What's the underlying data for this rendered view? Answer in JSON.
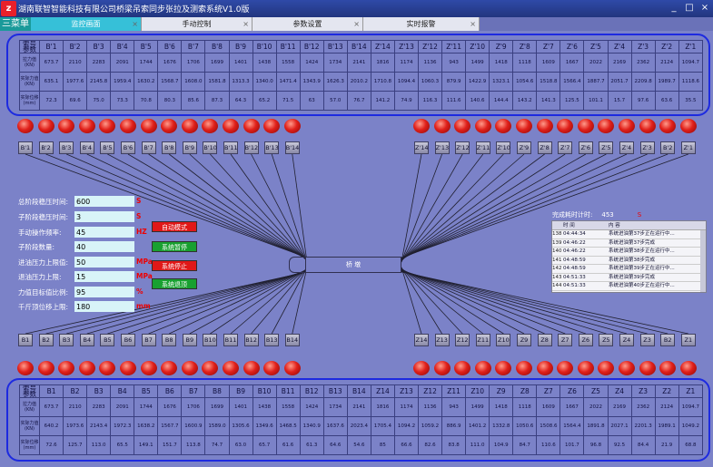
{
  "app": {
    "title": "湖南联智智能科技有限公司桥梁吊索同步张拉及测索系统V1.0版",
    "logo": "z",
    "win_min": "_",
    "win_max": "□",
    "win_close": "×"
  },
  "menu_label": "三菜单",
  "tabs": [
    {
      "label": "监控画面"
    },
    {
      "label": "手动控制"
    },
    {
      "label": "参数设置"
    },
    {
      "label": "实时报警"
    }
  ],
  "tab_close": "×",
  "row_labels": {
    "corner_top": "索号",
    "corner_bottom": "参数",
    "force": "拉力值(KN)",
    "actual_force": "实际力值(KN)",
    "displacement": "实际位移(mm)"
  },
  "top_table": {
    "headers": [
      "B'1",
      "B'2",
      "B'3",
      "B'4",
      "B'5",
      "B'6",
      "B'7",
      "B'8",
      "B'9",
      "B'10",
      "B'11",
      "B'12",
      "B'13",
      "B'14",
      "Z'14",
      "Z'13",
      "Z'12",
      "Z'11",
      "Z'10",
      "Z'9",
      "Z'8",
      "Z'7",
      "Z'6",
      "Z'5",
      "Z'4",
      "Z'3",
      "Z'2",
      "Z'1"
    ],
    "force": [
      "673.7",
      "2110",
      "2283",
      "2091",
      "1744",
      "1676",
      "1706",
      "1699",
      "1401",
      "1438",
      "1558",
      "1424",
      "1734",
      "2141",
      "1816",
      "1174",
      "1136",
      "943",
      "1499",
      "1418",
      "1118",
      "1609",
      "1667",
      "2022",
      "2169",
      "2362",
      "2124",
      "1094.7"
    ],
    "actual_force": [
      "635.1",
      "1977.6",
      "2145.8",
      "1959.4",
      "1630.2",
      "1568.7",
      "1608.0",
      "1581.8",
      "1313.3",
      "1340.0",
      "1471.4",
      "1343.9",
      "1626.3",
      "2010.2",
      "1710.8",
      "1094.4",
      "1060.3",
      "879.9",
      "1422.9",
      "1323.1",
      "1054.6",
      "1518.8",
      "1566.4",
      "1887.7",
      "2051.7",
      "2209.8",
      "1989.7",
      "1118.6"
    ],
    "displacement": [
      "72.3",
      "69.6",
      "75.0",
      "73.3",
      "70.8",
      "80.3",
      "85.6",
      "87.3",
      "64.3",
      "65.2",
      "71.5",
      "63",
      "57.0",
      "76.7",
      "141.2",
      "74.9",
      "116.3",
      "111.6",
      "140.6",
      "144.4",
      "143.2",
      "141.3",
      "125.5",
      "101.1",
      "15.7",
      "97.6",
      "63.6",
      "35.5"
    ]
  },
  "bottom_table": {
    "headers": [
      "B1",
      "B2",
      "B3",
      "B4",
      "B5",
      "B6",
      "B7",
      "B8",
      "B9",
      "B10",
      "B11",
      "B12",
      "B13",
      "B14",
      "Z14",
      "Z13",
      "Z12",
      "Z11",
      "Z10",
      "Z9",
      "Z8",
      "Z7",
      "Z6",
      "Z5",
      "Z4",
      "Z3",
      "Z2",
      "Z1"
    ],
    "force": [
      "673.7",
      "2110",
      "2283",
      "2091",
      "1744",
      "1676",
      "1706",
      "1699",
      "1401",
      "1438",
      "1558",
      "1424",
      "1734",
      "2141",
      "1816",
      "1174",
      "1136",
      "943",
      "1499",
      "1418",
      "1118",
      "1609",
      "1667",
      "2022",
      "2169",
      "2362",
      "2124",
      "1094.7"
    ],
    "actual_force": [
      "640.2",
      "1973.6",
      "2143.4",
      "1972.3",
      "1638.2",
      "1567.7",
      "1600.9",
      "1589.0",
      "1305.6",
      "1349.6",
      "1468.5",
      "1340.9",
      "1637.6",
      "2023.4",
      "1705.4",
      "1094.2",
      "1059.2",
      "886.9",
      "1401.2",
      "1332.8",
      "1050.6",
      "1508.6",
      "1564.4",
      "1891.8",
      "2027.1",
      "2201.3",
      "1989.1",
      "1049.2"
    ],
    "displacement": [
      "72.6",
      "125.7",
      "113.0",
      "65.5",
      "149.1",
      "151.7",
      "113.8",
      "74.7",
      "63.0",
      "65.7",
      "61.6",
      "61.3",
      "64.6",
      "54.6",
      "85",
      "66.6",
      "82.6",
      "83.8",
      "111.0",
      "104.9",
      "84.7",
      "110.6",
      "101.7",
      "96.8",
      "92.5",
      "84.4",
      "21.9",
      "68.8"
    ]
  },
  "top_jacks": {
    "left": [
      "B'1",
      "B'2",
      "B'3",
      "B'4",
      "B'5",
      "B'6",
      "B'7",
      "B'8",
      "B'9",
      "B'10",
      "B'11",
      "B'12",
      "B'13",
      "B'14"
    ],
    "right": [
      "Z'14",
      "Z'13",
      "Z'12",
      "Z'11",
      "Z'10",
      "Z'9",
      "Z'8",
      "Z'7",
      "Z'6",
      "Z'5",
      "Z'4",
      "Z'3",
      "B'2",
      "Z'1"
    ]
  },
  "bottom_jacks": {
    "left": [
      "B1",
      "B2",
      "B3",
      "B4",
      "B5",
      "B6",
      "B7",
      "B8",
      "B9",
      "B10",
      "B11",
      "B12",
      "B13",
      "B14"
    ],
    "right": [
      "Z14",
      "Z13",
      "Z12",
      "Z11",
      "Z10",
      "Z9",
      "Z8",
      "Z7",
      "Z6",
      "Z5",
      "Z4",
      "Z3",
      "B2",
      "Z1"
    ]
  },
  "params": [
    {
      "label": "总阶段稳压时间:",
      "value": "600",
      "unit": "S"
    },
    {
      "label": "子阶段稳压时间:",
      "value": "3",
      "unit": "S"
    },
    {
      "label": "手动操作频率:",
      "value": "45",
      "unit": "HZ"
    },
    {
      "label": "子阶段数量:",
      "value": "40",
      "unit": ""
    },
    {
      "label": "进油压力上限值:",
      "value": "50",
      "unit": "MPa"
    },
    {
      "label": "退油压力上限:",
      "value": "15",
      "unit": "MPa"
    },
    {
      "label": "力值目标值比例:",
      "value": "95",
      "unit": "%"
    },
    {
      "label": "千斤顶位移上限:",
      "value": "180",
      "unit": "mm"
    }
  ],
  "buttons": {
    "auto_mode": "自动模式",
    "system_pause": "系统暂停",
    "system_stop": "系统停止",
    "system_retract": "系统退顶"
  },
  "bridge_label": "桥  墩",
  "total_time": {
    "label": "完成耗时计时:",
    "value": "453",
    "unit": "S"
  },
  "log": {
    "col_time": "时 间",
    "col_content": "内 容",
    "rows": [
      {
        "n": "138",
        "time": "04:44:34",
        "msg": "系统进油第37步正在运行中..."
      },
      {
        "n": "139",
        "time": "04:46:22",
        "msg": "系统进油第37步完成"
      },
      {
        "n": "140",
        "time": "04:46:22",
        "msg": "系统进油第38步正在运行中..."
      },
      {
        "n": "141",
        "time": "04:48:59",
        "msg": "系统进油第38步完成"
      },
      {
        "n": "142",
        "time": "04:48:59",
        "msg": "系统进油第39步正在运行中..."
      },
      {
        "n": "143",
        "time": "04:51:33",
        "msg": "系统进油第39步完成"
      },
      {
        "n": "144",
        "time": "04:51:33",
        "msg": "系统进油第40步正在运行中..."
      }
    ]
  },
  "colors": {
    "auto_button": "#e01818",
    "pause_button": "#18a030",
    "stop_button": "#e01818",
    "retract_button": "#18a030",
    "light": "#e0201a",
    "panel_border": "#1d2ae0",
    "background": "#7b82c8"
  }
}
